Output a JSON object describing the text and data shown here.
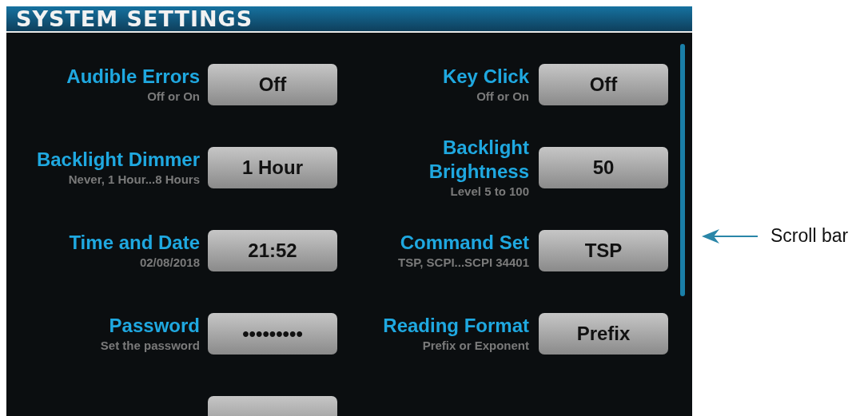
{
  "window": {
    "title": "SYSTEM SETTINGS"
  },
  "settings": [
    {
      "label": "Audible Errors",
      "hint": "Off or On",
      "value": "Off"
    },
    {
      "label": "Key Click",
      "hint": "Off or On",
      "value": "Off"
    },
    {
      "label": "Backlight Dimmer",
      "hint": "Never, 1 Hour...8 Hours",
      "value": "1 Hour"
    },
    {
      "label": "Backlight Brightness",
      "hint": "Level 5 to 100",
      "value": "50"
    },
    {
      "label": "Time and Date",
      "hint": "02/08/2018",
      "value": "21:52"
    },
    {
      "label": "Command Set",
      "hint": "TSP, SCPI...SCPI 34401",
      "value": "TSP"
    },
    {
      "label": "Password",
      "hint": "Set the password",
      "value": "•••••••••"
    },
    {
      "label": "Reading Format",
      "hint": "Prefix or Exponent",
      "value": "Prefix"
    }
  ],
  "annotation": {
    "text": "Scroll bar"
  }
}
